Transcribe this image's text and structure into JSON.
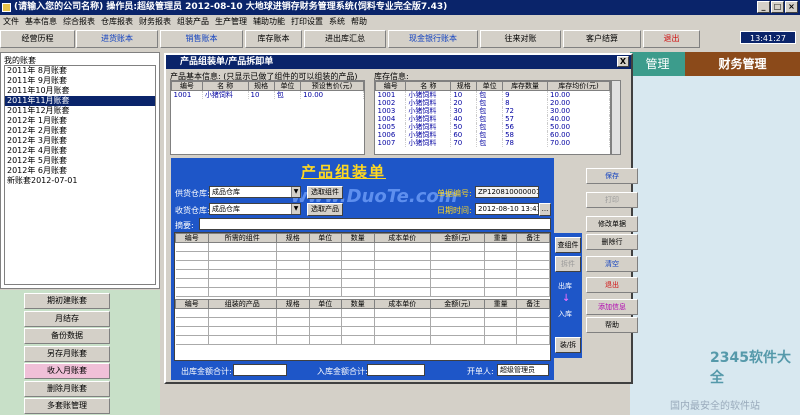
{
  "app": {
    "title": "(请输入您的公司名称)    操作员:超级管理员    2012-08-10    大地球进销存财务管理系统(饲料专业完全版7.43)"
  },
  "menu": [
    "文件",
    "基本信息",
    "综合报表",
    "仓库报表",
    "财务报表",
    "组装产品",
    "生产管理",
    "辅助功能",
    "打印设置",
    "系统",
    "帮助"
  ],
  "nav": {
    "items": [
      {
        "label": "经营历程",
        "style": ""
      },
      {
        "label": "进货账本",
        "style": "blue"
      },
      {
        "label": "销售账本",
        "style": "blue"
      },
      {
        "label": "库存账本",
        "style": ""
      },
      {
        "label": "进出库汇总",
        "style": ""
      },
      {
        "label": "现金银行账本",
        "style": "blue"
      },
      {
        "label": "往来对账",
        "style": ""
      },
      {
        "label": "客户结算",
        "style": ""
      },
      {
        "label": "退出",
        "style": "red"
      }
    ],
    "clock": "13:41:27"
  },
  "left": {
    "header": "我的账套",
    "periods": [
      "2011年 8月账套",
      "2011年 9月账套",
      "2011年10月账套",
      "2011年11月账套",
      "2011年12月账套",
      "2012年 1月账套",
      "2012年 2月账套",
      "2012年 3月账套",
      "2012年 4月账套",
      "2012年 5月账套",
      "2012年 6月账套",
      "新账套2012-07-01"
    ],
    "selected_index": 3,
    "buttons": [
      {
        "label": "期初建账套",
        "style": ""
      },
      {
        "label": "月结存",
        "style": ""
      },
      {
        "label": "备份数据",
        "style": ""
      },
      {
        "label": "另存月账套",
        "style": ""
      },
      {
        "label": "收入月账套",
        "style": "pink"
      },
      {
        "label": "删除月账套",
        "style": ""
      },
      {
        "label": "多套账管理",
        "style": ""
      }
    ]
  },
  "right": {
    "teal_label": "管理",
    "finance_label": "财务管理",
    "watermark_brand": "2345软件大全",
    "watermark_text": "国内最安全的软件站"
  },
  "dialog": {
    "title": "产品组装单/产品拆卸单",
    "close": "X",
    "product_info_label": "产品基本信息: (只显示已做了组件的可以组装的产品)",
    "product_headers": [
      "编号",
      "名  称",
      "规格",
      "单位",
      "预设售价(元)"
    ],
    "products": [
      [
        "1001",
        "小猪饲料",
        "10",
        "包",
        "10.00"
      ]
    ],
    "stock_label": "库存信息:",
    "stock_headers": [
      "编号",
      "名  称",
      "规格",
      "单位",
      "库存数量",
      "库存均价(元)"
    ],
    "stock": [
      [
        "1001",
        "小猪饲料",
        "10",
        "包",
        "9",
        "10.00"
      ],
      [
        "1002",
        "小猪饲料",
        "20",
        "包",
        "8",
        "20.00"
      ],
      [
        "1003",
        "小猪饲料",
        "30",
        "包",
        "72",
        "30.00"
      ],
      [
        "1004",
        "小猪饲料",
        "40",
        "包",
        "57",
        "40.00"
      ],
      [
        "1005",
        "小猪饲料",
        "50",
        "包",
        "56",
        "50.00"
      ],
      [
        "1006",
        "小猪饲料",
        "60",
        "包",
        "58",
        "60.00"
      ],
      [
        "1007",
        "小猪饲料",
        "70",
        "包",
        "78",
        "70.00"
      ]
    ],
    "form": {
      "title": "产品组装单",
      "ship_wh_label": "供货仓库:",
      "ship_wh_value": "成品仓库",
      "select_comp_btn": "选取组件",
      "recv_wh_label": "收货仓库:",
      "recv_wh_value": "成品仓库",
      "select_prod_btn": "选取产品",
      "doc_no_label": "单据编号:",
      "doc_no_value": "ZP120810000001",
      "date_label": "日期时间:",
      "date_value": "2012-08-10 13:41:26",
      "date_btn": "...",
      "memo_label": "摘要:",
      "out_total_label": "出库金额合计:",
      "in_total_label": "入库金额合计:",
      "handler_label": "开单人:",
      "handler_value": "超级管理员",
      "watermark": "www.DuoTe.com"
    },
    "comp_headers": [
      "编号",
      "所需的组件",
      "规格",
      "单位",
      "数量",
      "成本单价",
      "金额(元)",
      "重量",
      "备注"
    ],
    "prod_headers": [
      "编号",
      "组装的产品",
      "规格",
      "单位",
      "数量",
      "成本单价",
      "金额(元)",
      "重量",
      "备注"
    ],
    "mid": {
      "view_comp": "查组件",
      "split": "拆件",
      "out_label": "出库",
      "in_label": "入库",
      "toggle": "装/拆"
    },
    "side_buttons": [
      {
        "label": "保存",
        "style": "blue"
      },
      {
        "label": "打印",
        "style": "gray"
      },
      {
        "label": "修改单据",
        "style": ""
      },
      {
        "label": "删除行",
        "style": ""
      },
      {
        "label": "清空",
        "style": "blue"
      },
      {
        "label": "退出",
        "style": "red"
      },
      {
        "label": "添加信息",
        "style": "mag"
      },
      {
        "label": "帮助",
        "style": ""
      }
    ]
  },
  "colors": {
    "titlebar": "#0a246a",
    "form_blue": "#1e56c8",
    "form_title": "#ffd820",
    "finance": "#8b4a1a"
  }
}
